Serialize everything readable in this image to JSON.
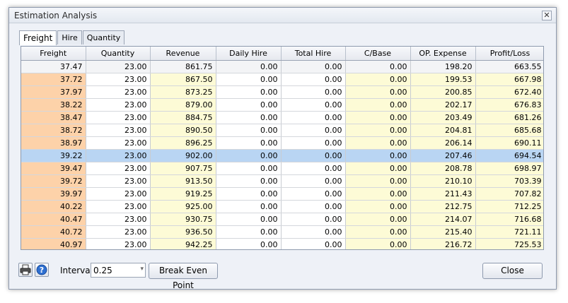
{
  "window": {
    "title": "Estimation Analysis",
    "close_glyph": "✕"
  },
  "tabs": [
    {
      "label": "Freight",
      "active": true
    },
    {
      "label": "Hire",
      "active": false
    },
    {
      "label": "Quantity",
      "active": false
    }
  ],
  "table": {
    "columns": [
      "Freight",
      "Quantity",
      "Revenue",
      "Daily Hire",
      "Total Hire",
      "C/Base",
      "OP. Expense",
      "Profit/Loss"
    ],
    "selected_row": 7,
    "rows": [
      [
        "37.47",
        "23.00",
        "861.75",
        "0.00",
        "0.00",
        "0.00",
        "198.20",
        "663.55"
      ],
      [
        "37.72",
        "23.00",
        "867.50",
        "0.00",
        "0.00",
        "0.00",
        "199.53",
        "667.98"
      ],
      [
        "37.97",
        "23.00",
        "873.25",
        "0.00",
        "0.00",
        "0.00",
        "200.85",
        "672.40"
      ],
      [
        "38.22",
        "23.00",
        "879.00",
        "0.00",
        "0.00",
        "0.00",
        "202.17",
        "676.83"
      ],
      [
        "38.47",
        "23.00",
        "884.75",
        "0.00",
        "0.00",
        "0.00",
        "203.49",
        "681.26"
      ],
      [
        "38.72",
        "23.00",
        "890.50",
        "0.00",
        "0.00",
        "0.00",
        "204.81",
        "685.68"
      ],
      [
        "38.97",
        "23.00",
        "896.25",
        "0.00",
        "0.00",
        "0.00",
        "206.14",
        "690.11"
      ],
      [
        "39.22",
        "23.00",
        "902.00",
        "0.00",
        "0.00",
        "0.00",
        "207.46",
        "694.54"
      ],
      [
        "39.47",
        "23.00",
        "907.75",
        "0.00",
        "0.00",
        "0.00",
        "208.78",
        "698.97"
      ],
      [
        "39.72",
        "23.00",
        "913.50",
        "0.00",
        "0.00",
        "0.00",
        "210.10",
        "703.39"
      ],
      [
        "39.97",
        "23.00",
        "919.25",
        "0.00",
        "0.00",
        "0.00",
        "211.43",
        "707.82"
      ],
      [
        "40.22",
        "23.00",
        "925.00",
        "0.00",
        "0.00",
        "0.00",
        "212.75",
        "712.25"
      ],
      [
        "40.47",
        "23.00",
        "930.75",
        "0.00",
        "0.00",
        "0.00",
        "214.07",
        "716.68"
      ],
      [
        "40.72",
        "23.00",
        "936.50",
        "0.00",
        "0.00",
        "0.00",
        "215.40",
        "721.11"
      ],
      [
        "40.97",
        "23.00",
        "942.25",
        "0.00",
        "0.00",
        "0.00",
        "216.72",
        "725.53"
      ]
    ]
  },
  "footer": {
    "interval_label": "Interval",
    "interval_value": "0.25",
    "spin_glyph": "▾",
    "break_even_label": "Break Even Point",
    "close_label": "Close",
    "icons": [
      "printer-icon",
      "help-icon"
    ]
  },
  "colors": {
    "freight_cell": "#fdd2a9",
    "highlight_cell": "#fdfbd6",
    "selected_row": "#b9d5f3",
    "first_row": "#f3f4f6"
  }
}
